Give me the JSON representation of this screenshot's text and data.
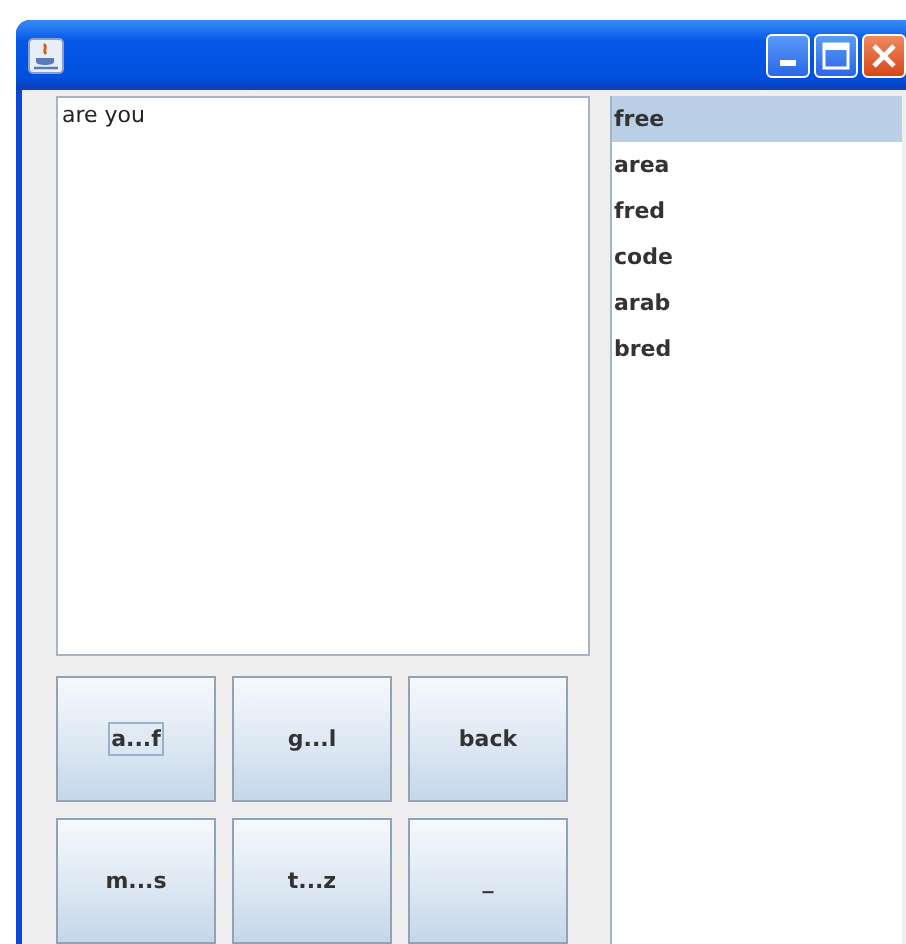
{
  "text_area": {
    "value": "are you"
  },
  "buttons": [
    {
      "label": "a...f",
      "focused": true
    },
    {
      "label": "g...l",
      "focused": false
    },
    {
      "label": "back",
      "focused": false
    },
    {
      "label": "m...s",
      "focused": false
    },
    {
      "label": "t...z",
      "focused": false
    },
    {
      "label": "_",
      "focused": false
    }
  ],
  "suggestions": [
    {
      "label": "free",
      "selected": true
    },
    {
      "label": "area",
      "selected": false
    },
    {
      "label": "fred",
      "selected": false
    },
    {
      "label": "code",
      "selected": false
    },
    {
      "label": "arab",
      "selected": false
    },
    {
      "label": "bred",
      "selected": false
    }
  ]
}
